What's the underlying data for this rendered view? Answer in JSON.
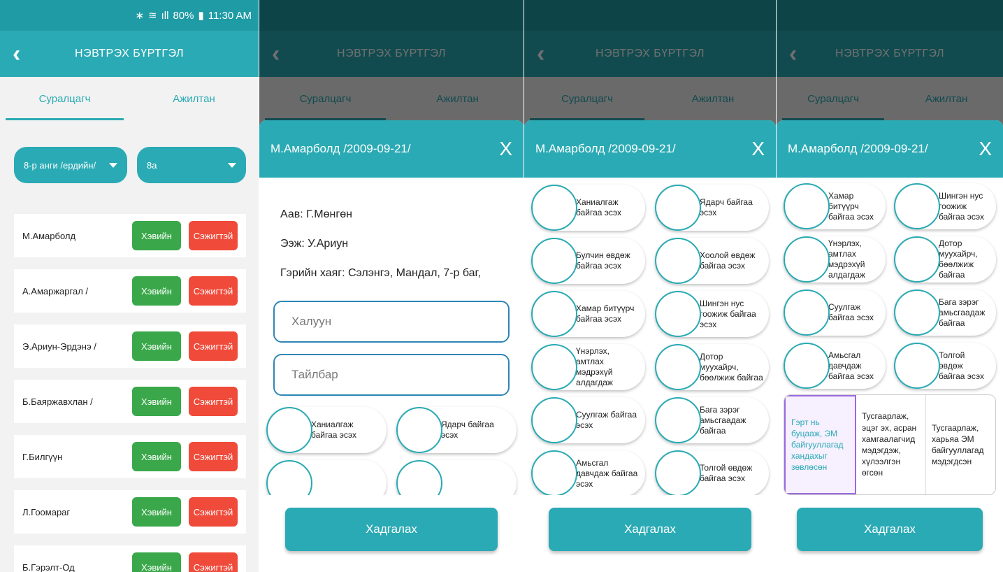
{
  "status": {
    "bt": "∗",
    "wifi": "≋",
    "signal": "ıll",
    "battery": "80%",
    "battery_icon": "▮",
    "time": "11:30 AM"
  },
  "appbar": {
    "back": "‹",
    "title": "НЭВТРЭХ БҮРТГЭЛ"
  },
  "tabs": {
    "student": "Суралцагч",
    "staff": "Ажилтан"
  },
  "filters": {
    "grade": "8-р анги  /ердийн/",
    "class": "8а"
  },
  "buttons": {
    "normal": "Хэвийн",
    "suspect": "Сэжигтэй",
    "save": "Хадгалах",
    "close": "X"
  },
  "students": [
    "М.Амарболд",
    "А.Амаржаргал /",
    "Э.Ариун-Эрдэнэ /",
    "Б.Баяржавхлан /",
    "Г.Билгүүн",
    "Л.Гоомараг",
    "Б.Гэрэлт-Од"
  ],
  "modal": {
    "title": "М.Амарболд /2009-09-21/",
    "father": "Аав: Г.Мөнгөн",
    "mother": "Ээж: У.Ариун",
    "address": "Гэрийн хаяг: Сэлэнгэ, Мандал, 7-р баг,",
    "temp_placeholder": "Халуун",
    "note_placeholder": "Тайлбар"
  },
  "symptoms": [
    "Ханиалгаж байгаа эсэх",
    "Ядарч байгаа эсэх",
    "Булчин өвдөж байгаа эсэх",
    "Хоолой өвдөж байгаа эсэх",
    "Хамар битүүрч байгаа эсэх",
    "Шингэн нус гоожиж байгаа эсэх",
    "Үнэрлэх, амтлах мэдрэхүй алдагдаж",
    "Дотор муухайрч, бөөлжиж байгаа",
    "Суулгаж байгаа эсэх",
    "Бага зэрэг амьсгаадаж байгаа",
    "Амьсгал давчдаж байгаа эсэх",
    "Толгой өвдөж байгаа эсэх"
  ],
  "outcomes": [
    "Гэрт нь буцааж, ЭМ байгууллагад хандахыг зөвлөсөн",
    "Тусгаарлаж, эцэг эх, асран хамгаалагчид мэдэгдэж, хүлээлгэн өгсөн",
    "Тусгаарлаж, харьяа ЭМ байгууллагад мэдэгдсэн"
  ]
}
